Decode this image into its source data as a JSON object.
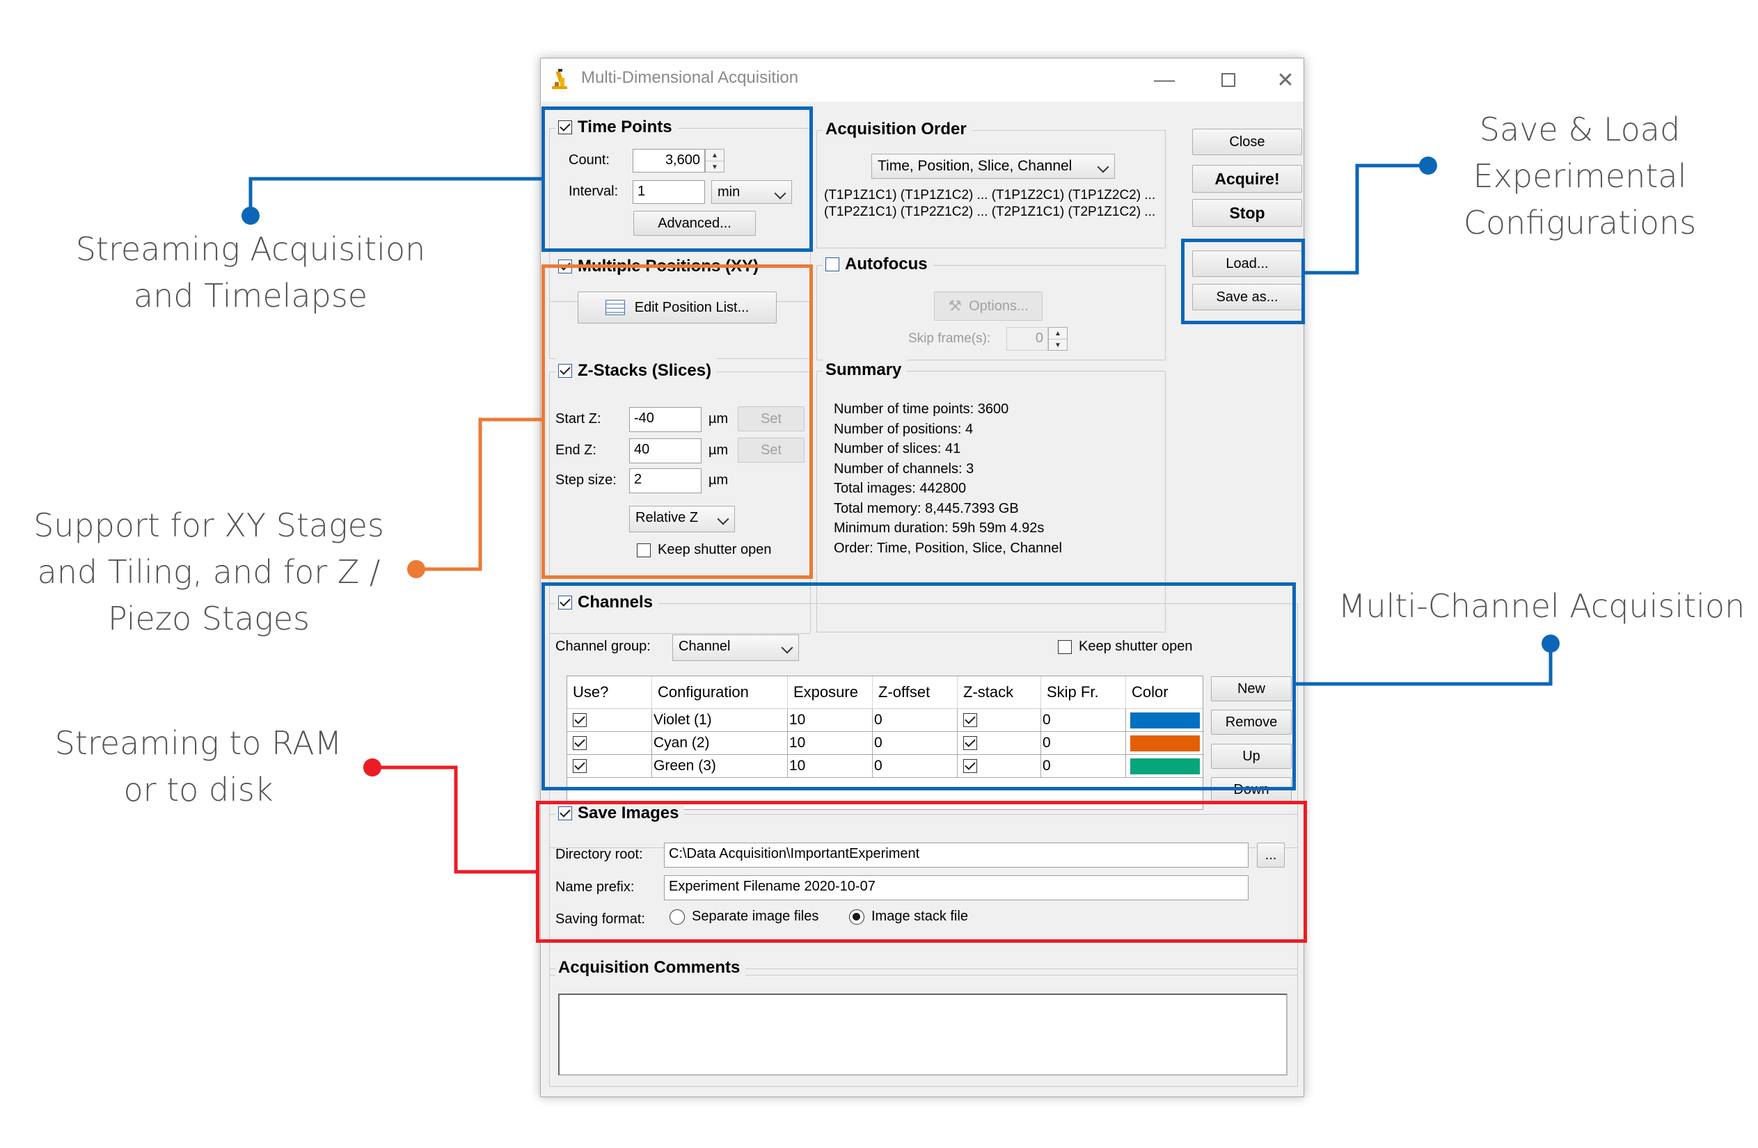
{
  "callouts": {
    "streaming": [
      "Streaming Acquisition",
      "and Timelapse"
    ],
    "save_load": [
      "Save & Load",
      "Experimental",
      "Configurations"
    ],
    "xy_z": [
      "Support for XY Stages",
      "and Tiling, and for Z /",
      "Piezo Stages"
    ],
    "multichannel": "Multi-Channel Acquisition",
    "ram": [
      "Streaming to RAM",
      "or to disk"
    ]
  },
  "colors": {
    "blue_highlight": "#0c66b7",
    "orange_highlight": "#ec7a34",
    "red_highlight": "#ec1c24",
    "callout_text": "#555555"
  },
  "window": {
    "title": "Multi-Dimensional Acquisition",
    "app_icon": "microscope-icon",
    "controls": [
      "minimize-icon",
      "maximize-icon",
      "close-icon"
    ]
  },
  "time_points": {
    "label": "Time Points",
    "checked": true,
    "count_label": "Count:",
    "count_value": "3,600",
    "interval_label": "Interval:",
    "interval_value": "1",
    "interval_unit": "min",
    "advanced_button": "Advanced..."
  },
  "acquisition_order": {
    "label": "Acquisition Order",
    "selected": "Time, Position, Slice, Channel",
    "preview_line1": "(T1P1Z1C1) (T1P1Z1C2) ... (T1P1Z2C1) (T1P1Z2C2) ...",
    "preview_line2": "(T1P2Z1C1) (T1P2Z1C2) ... (T2P1Z1C1) (T2P1Z1C2) ..."
  },
  "side_buttons": {
    "close": "Close",
    "acquire": "Acquire!",
    "stop": "Stop",
    "load": "Load...",
    "save_as": "Save as..."
  },
  "positions": {
    "label": "Multiple Positions (XY)",
    "checked": true,
    "edit_button": "Edit Position List..."
  },
  "autofocus": {
    "label": "Autofocus",
    "checked": false,
    "options_button": "Options...",
    "skip_label": "Skip frame(s):",
    "skip_value": "0"
  },
  "zstacks": {
    "label": "Z-Stacks (Slices)",
    "checked": true,
    "start_label": "Start Z:",
    "start_value": "-40",
    "end_label": "End Z:",
    "end_value": "40",
    "step_label": "Step size:",
    "step_value": "2",
    "unit": "µm",
    "set_button": "Set",
    "mode": "Relative Z",
    "keep_shutter": "Keep shutter open",
    "keep_shutter_checked": false
  },
  "summary": {
    "label": "Summary",
    "lines": [
      "Number of time points: 3600",
      "Number of positions: 4",
      "Number of slices: 41",
      "Number of channels: 3",
      "Total images: 442800",
      "Total memory: 8,445.7393 GB",
      "Minimum duration: 59h 59m 4.92s",
      "Order: Time, Position, Slice, Channel"
    ]
  },
  "channels": {
    "label": "Channels",
    "checked": true,
    "group_label": "Channel group:",
    "group_value": "Channel",
    "keep_shutter": "Keep shutter open",
    "keep_shutter_checked": false,
    "columns": [
      "Use?",
      "Configuration",
      "Exposure",
      "Z-offset",
      "Z-stack",
      "Skip Fr.",
      "Color"
    ],
    "rows": [
      {
        "use": true,
        "config": "Violet (1)",
        "exposure": "10",
        "zoffset": "0",
        "zstack": true,
        "skip": "0",
        "color": "#0070c0"
      },
      {
        "use": true,
        "config": "Cyan (2)",
        "exposure": "10",
        "zoffset": "0",
        "zstack": true,
        "skip": "0",
        "color": "#e35f06"
      },
      {
        "use": true,
        "config": "Green (3)",
        "exposure": "10",
        "zoffset": "0",
        "zstack": true,
        "skip": "0",
        "color": "#07a57a"
      }
    ],
    "buttons": {
      "new": "New",
      "remove": "Remove",
      "up": "Up",
      "down": "Down"
    }
  },
  "save_images": {
    "label": "Save Images",
    "checked": true,
    "dir_label": "Directory root:",
    "dir_value": "C:\\Data Acquisition\\ImportantExperiment",
    "browse": "...",
    "prefix_label": "Name prefix:",
    "prefix_value": "Experiment Filename 2020-10-07",
    "format_label": "Saving format:",
    "format_options": [
      "Separate image files",
      "Image stack file"
    ],
    "format_selected": "Image stack file"
  },
  "comments": {
    "label": "Acquisition Comments",
    "value": ""
  }
}
